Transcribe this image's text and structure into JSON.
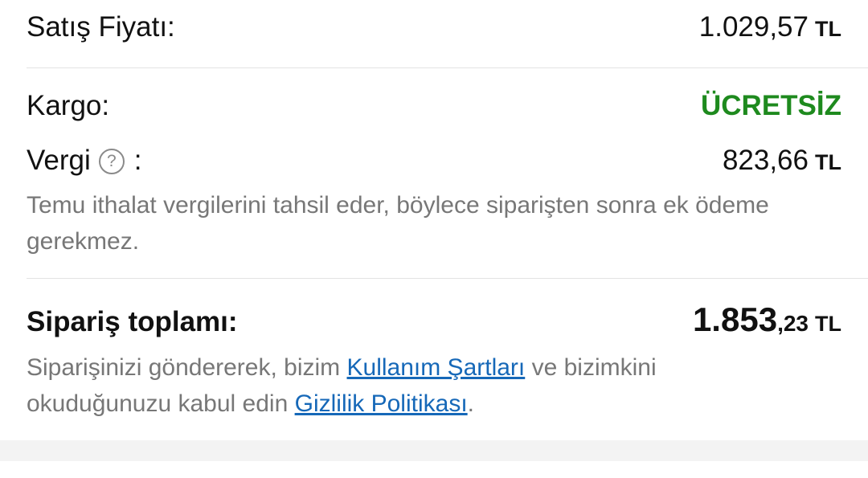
{
  "sale_price": {
    "label": "Satış Fiyatı:",
    "value": "1.029,57",
    "currency": "TL"
  },
  "shipping": {
    "label": "Kargo:",
    "value": "ÜCRETSİZ",
    "color": "#1e8a1e"
  },
  "tax": {
    "label": "Vergi",
    "help_icon_glyph": "?",
    "colon": ":",
    "value": "823,66",
    "currency": "TL",
    "note": "Temu ithalat vergilerini tahsil eder, böylece siparişten sonra ek ödeme gerekmez."
  },
  "total": {
    "label": "Sipariş toplamı:",
    "value_int": "1.853",
    "value_dec": ",23",
    "currency": "TL"
  },
  "terms": {
    "text_before": "Siparişinizi göndererek, bizim ",
    "terms_link": "Kullanım Şartları",
    "text_middle": " ve bizimkini okuduğunuzu kabul edin ",
    "privacy_link": "Gizlilik Politikası",
    "text_after": ".",
    "link_color": "#1668b8"
  }
}
